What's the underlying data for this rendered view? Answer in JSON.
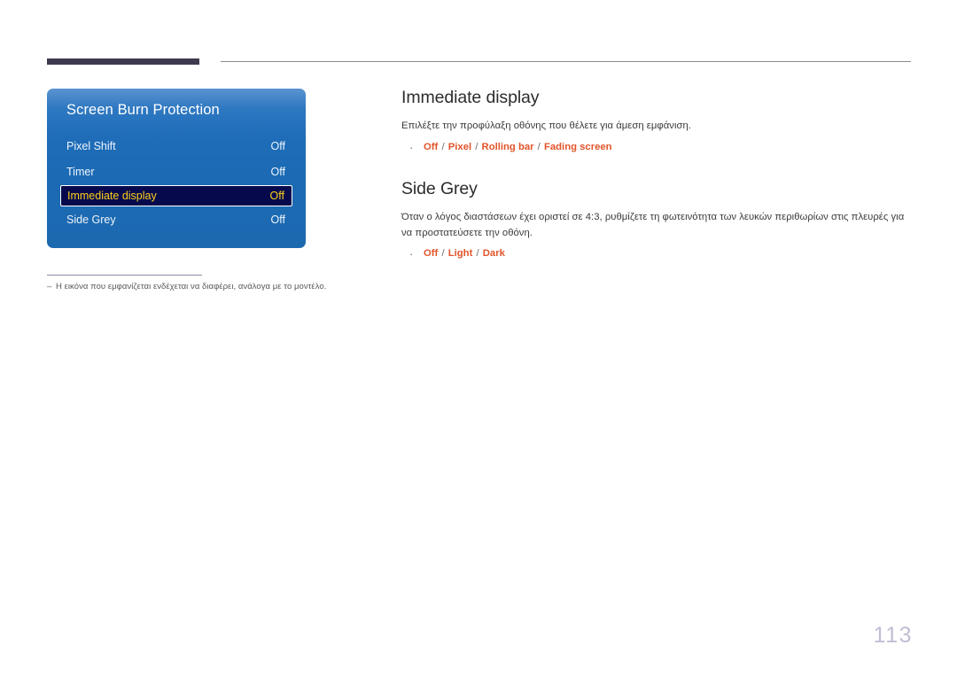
{
  "page": {
    "number": "113"
  },
  "osd": {
    "title": "Screen Burn Protection",
    "rows": [
      {
        "label": "Pixel Shift",
        "value": "Off",
        "selected": false
      },
      {
        "label": "Timer",
        "value": "Off",
        "selected": false
      },
      {
        "label": "Immediate display",
        "value": "Off",
        "selected": true
      },
      {
        "label": "Side Grey",
        "value": "Off",
        "selected": false
      }
    ],
    "colors": {
      "panel_top": "#5b93d0",
      "panel_bottom": "#1d69b0",
      "selected_bg": "#060a4c",
      "selected_text": "#fcd11c",
      "row_text": "#eef4fb"
    }
  },
  "footnote": {
    "dash": "–",
    "text": "Η εικόνα που εμφανίζεται ενδέχεται να διαφέρει, ανάλογα με το μοντέλο."
  },
  "sections": [
    {
      "heading": "Immediate display",
      "description": "Επιλέξτε την προφύλαξη οθόνης που θέλετε για άμεση εμφάνιση.",
      "options": [
        "Off",
        "Pixel",
        "Rolling bar",
        "Fading screen"
      ]
    },
    {
      "heading": "Side Grey",
      "description": "Όταν ο λόγος διαστάσεων έχει οριστεί σε 4:3, ρυθμίζετε τη φωτεινότητα των λευκών περιθωρίων στις πλευρές για να προστατεύσετε την οθόνη.",
      "options": [
        "Off",
        "Light",
        "Dark"
      ]
    }
  ],
  "theme": {
    "accent_orange": "#e2542a",
    "rule_dark": "#3f3a4e",
    "rule_light": "#8b8b90",
    "page_number_color": "#bfbed4"
  }
}
